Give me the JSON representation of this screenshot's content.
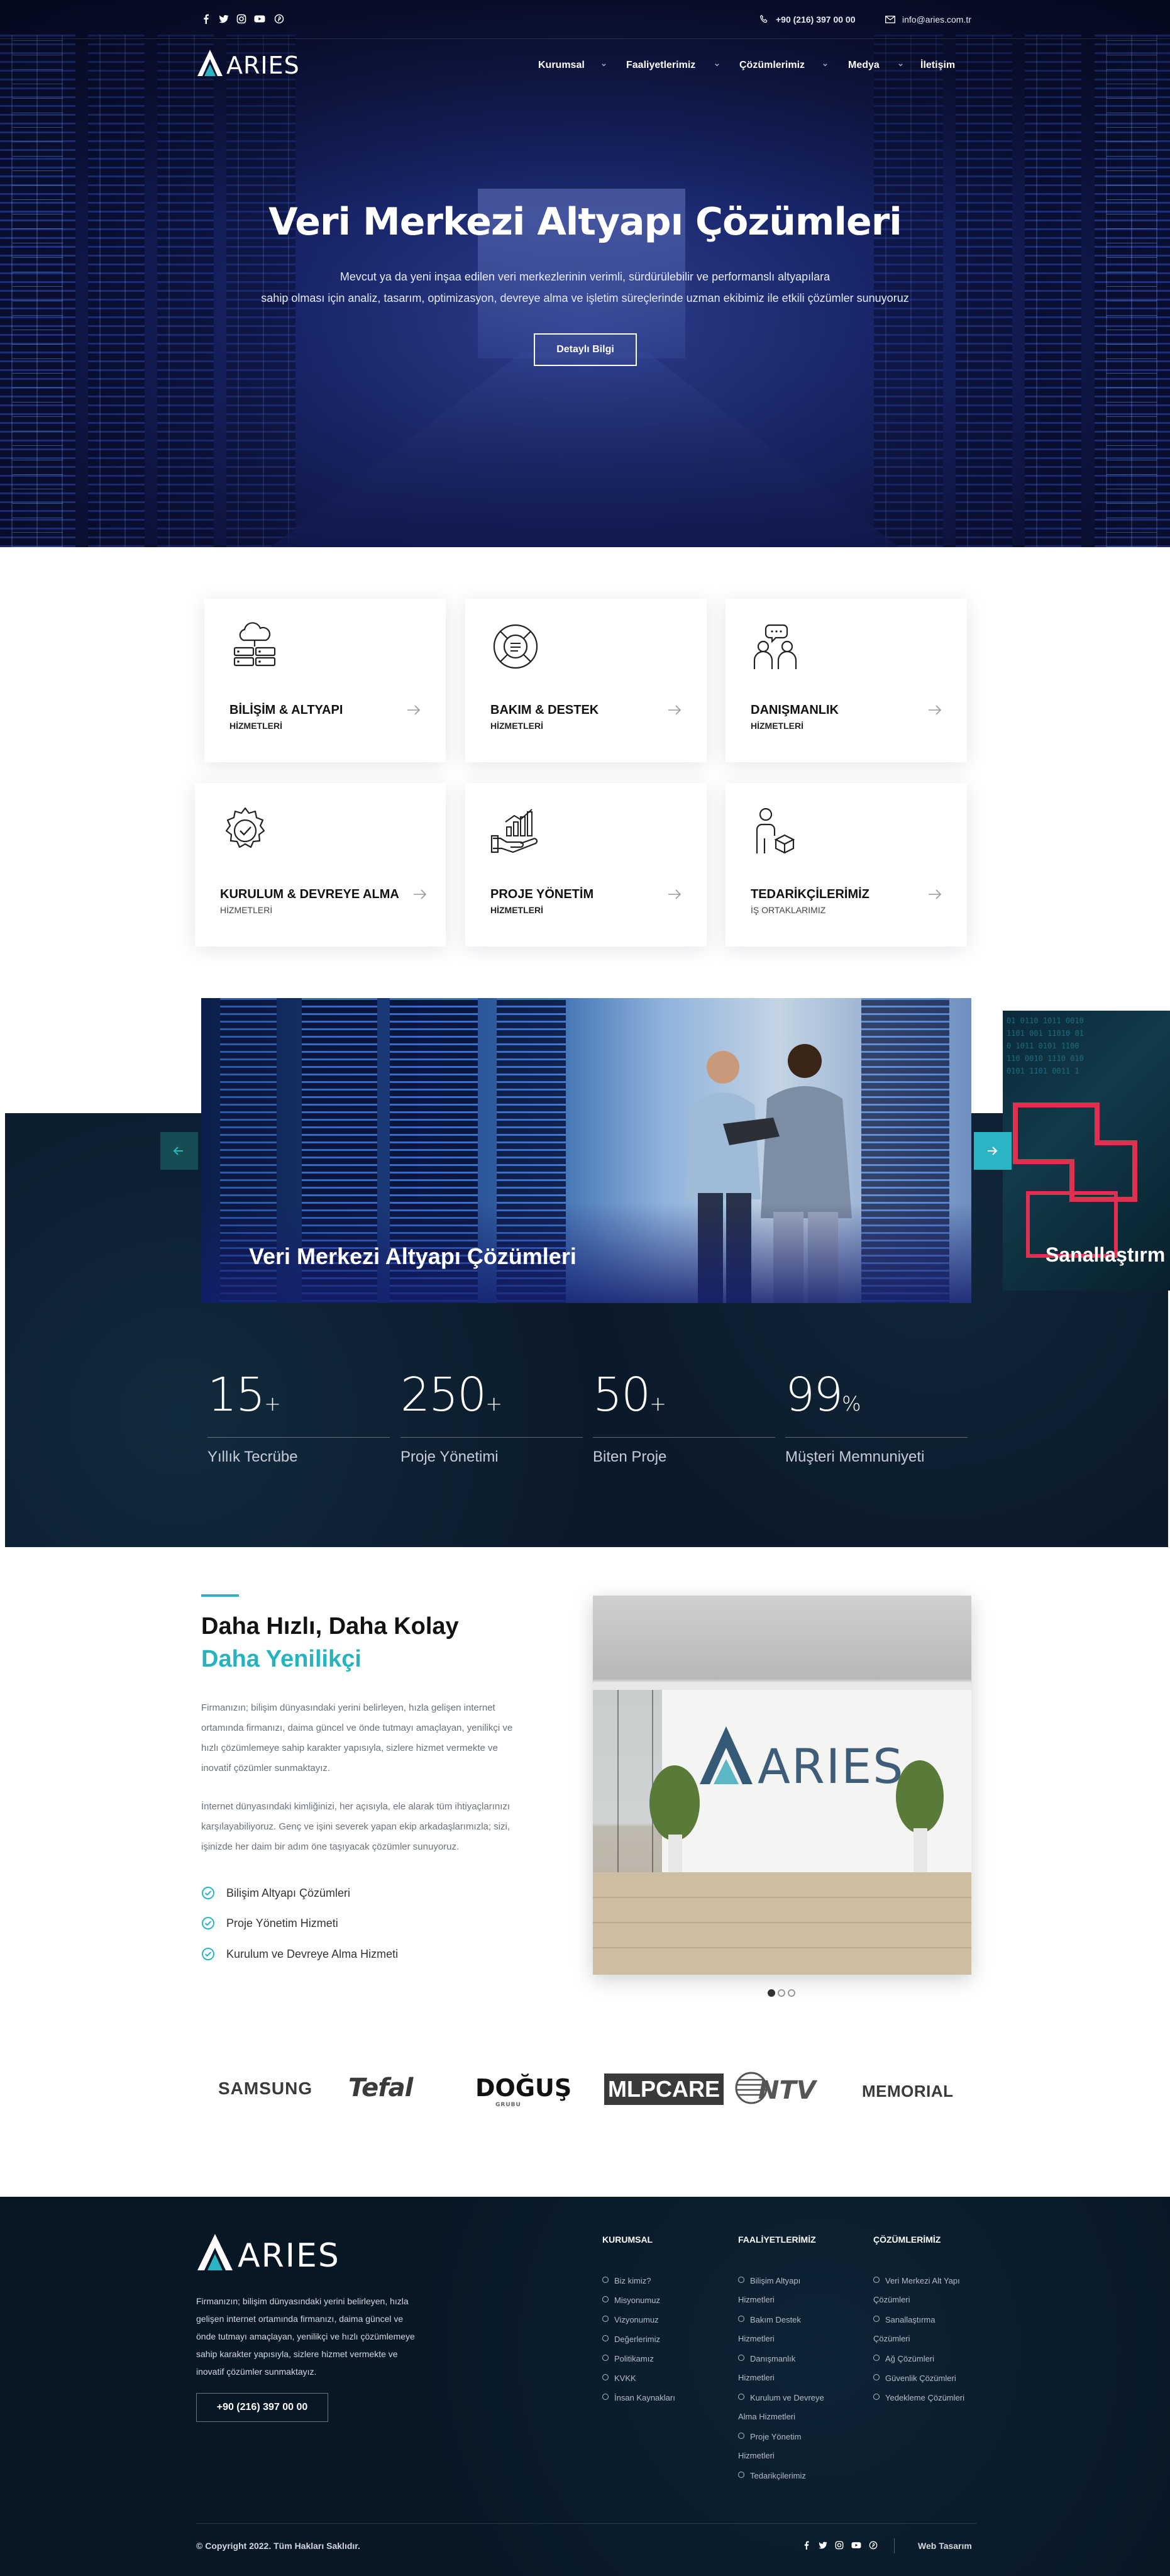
{
  "topbar": {
    "social": [
      "facebook-icon",
      "twitter-icon",
      "instagram-icon",
      "youtube-icon",
      "pinterest-icon"
    ],
    "phone": "+90 (216) 397 00 00",
    "email": "info@aries.com.tr"
  },
  "brand": {
    "name": "ARIES",
    "accent": "#2bb5c4",
    "dark": "#0b1a2a"
  },
  "nav": [
    {
      "label": "Kurumsal",
      "dropdown": true
    },
    {
      "label": "Faaliyetlerimiz",
      "dropdown": true
    },
    {
      "label": "Çözümlerimiz",
      "dropdown": true
    },
    {
      "label": "Medya",
      "dropdown": true
    },
    {
      "label": "İletişim",
      "dropdown": false
    }
  ],
  "hero": {
    "title": "Veri Merkezi Altyapı Çözümleri",
    "subtitle_1": "Mevcut ya da yeni inşaa edilen veri merkezlerinin verimli, sürdürülebilir ve performanslı altyapılara",
    "subtitle_2": "sahip olması için analiz, tasarım, optimizasyon, devreye alma ve işletim süreçlerinde uzman ekibimiz ile etkili çözümler sunuyoruz",
    "button": "Detaylı Bilgi"
  },
  "services": [
    {
      "title": "BİLİŞİM & ALTYAPI",
      "subtitle": "HİZMETLERİ",
      "icon": "cloud-server-icon"
    },
    {
      "title": "BAKIM & DESTEK",
      "subtitle": "HİZMETLERİ",
      "icon": "lifebuoy-icon"
    },
    {
      "title": "DANIŞMANLIK",
      "subtitle": "HİZMETLERİ",
      "icon": "consulting-icon"
    },
    {
      "title": "KURULUM & DEVREYE ALMA",
      "subtitle": "HİZMETLERİ",
      "icon": "gear-check-icon"
    },
    {
      "title": "PROJE YÖNETİM",
      "subtitle": "HİZMETLERİ",
      "icon": "hand-chart-icon"
    },
    {
      "title": "TEDARİKÇİLERİMİZ",
      "subtitle": "İŞ ORTAKLARIMIZ",
      "icon": "supplier-icon"
    }
  ],
  "slider": {
    "main_caption": "Veri Merkezi Altyapı Çözümleri",
    "side_caption": "Sanallaştırm"
  },
  "stats": [
    {
      "value": "15",
      "suffix": "+",
      "label": "Yıllık Tecrübe"
    },
    {
      "value": "250",
      "suffix": "+",
      "label": "Proje Yönetimi"
    },
    {
      "value": "50",
      "suffix": "+",
      "label": "Biten Proje"
    },
    {
      "value": "99",
      "suffix": "%",
      "label": "Müşteri Memnuniyeti"
    }
  ],
  "about": {
    "heading_1": "Daha Hızlı, Daha Kolay",
    "heading_2": "Daha Yenilikçi",
    "para_1_l1": "Firmanızın; bilişim dünyasındaki yerini belirleyen, hızla gelişen internet",
    "para_1_l2": "ortamında firmanızı, daima güncel ve önde tutmayı amaçlayan, yenilikçi ve",
    "para_1_l3": "hızlı çözümlemeye sahip karakter yapısıyla, sizlere hizmet vermekte ve",
    "para_1_l4": "inovatif çözümler sunmaktayız.",
    "para_2_l1": "İnternet dünyasındaki kimliğinizi, her açısıyla, ele alarak tüm ihtiyaçlarınızı",
    "para_2_l2": "karşılayabiliyoruz. Genç ve işini severek yapan ekip arkadaşlarımızla; sizi,",
    "para_2_l3": "işinizde her daim bir adım öne taşıyacak çözümler sunuyoruz.",
    "checklist": [
      "Bilişim Altyapı Çözümleri",
      "Proje Yönetim Hizmeti",
      "Kurulum ve Devreye Alma Hizmeti"
    ],
    "image_logo": "ARIES"
  },
  "brands": [
    "SAMSUNG",
    "Tefal",
    "DOĞUŞ",
    "MLPCARE",
    "NTV",
    "MEMORIAL"
  ],
  "brands_sub": {
    "dogus": "GRUBU"
  },
  "footer": {
    "about_l1": "Firmanızın; bilişim dünyasındaki yerini belirleyen, hızla",
    "about_l2": "gelişen internet ortamında firmanızı, daima güncel ve",
    "about_l3": "önde tutmayı amaçlayan, yenilikçi ve hızlı çözümlemeye",
    "about_l4": "sahip karakter yapısıyla, sizlere hizmet vermekte ve",
    "about_l5": "inovatif çözümler sunmaktayız.",
    "phone": "+90 (216) 397 00 00",
    "col1_title": "KURUMSAL",
    "col1": [
      "Biz kimiz?",
      "Misyonumuz",
      "Vizyonumuz",
      "Değerlerimiz",
      "Politikamız",
      "KVKK",
      "İnsan Kaynakları"
    ],
    "col2_title": "FAALİYETLERİMİZ",
    "col2": [
      "Bilişim Altyapı",
      "Hizmetleri",
      "Bakım Destek",
      "Hizmetleri",
      "Danışmanlık",
      "Hizmetleri",
      "Kurulum ve Devreye",
      "Alma Hizmetleri",
      "Proje Yönetim",
      "Hizmetleri",
      "Tedarikçilerimiz"
    ],
    "col3_title": "ÇÖZÜMLERİMİZ",
    "col3": [
      "Veri Merkezi Alt Yapı",
      "Çözümleri",
      "Sanallaştırma",
      "Çözümleri",
      "Ağ Çözümleri",
      "Güvenlik Çözümleri",
      "Yedekleme Çözümleri"
    ],
    "copyright": "© Copyright 2022. Tüm Hakları Saklıdır.",
    "design": "Web Tasarım"
  }
}
